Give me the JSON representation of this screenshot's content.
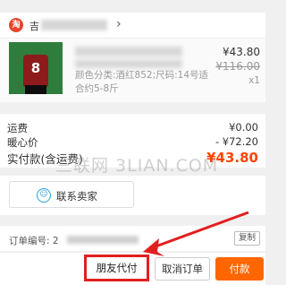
{
  "store": {
    "icon_glyph": "淘",
    "name_visible": "吉"
  },
  "item": {
    "jersey_number": "8",
    "attributes": "颜色分类:酒红852;尺码:14号适合约5-8斤",
    "price_now": "¥43.80",
    "price_original": "¥116.00",
    "quantity": "x1"
  },
  "summary": {
    "shipping_label": "运费",
    "shipping_value": "¥0.00",
    "discount_label": "暖心价",
    "discount_value": "- ¥72.20",
    "total_label": "实付款(含运费)",
    "total_value": "¥43.80"
  },
  "watermark": "三联网 3LIAN.COM",
  "contact": {
    "label": "联系卖家",
    "icon": "chat-smile-icon"
  },
  "order": {
    "label": "订单编号: 2",
    "copy_label": "复制"
  },
  "actions": {
    "friend_pay": "朋友代付",
    "cancel_order": "取消订单",
    "pay": "付款"
  },
  "colors": {
    "accent_orange": "#ff6600",
    "price_red": "#ff4400",
    "highlight_red": "#e21f1f",
    "contact_blue": "#2aa0e0"
  }
}
